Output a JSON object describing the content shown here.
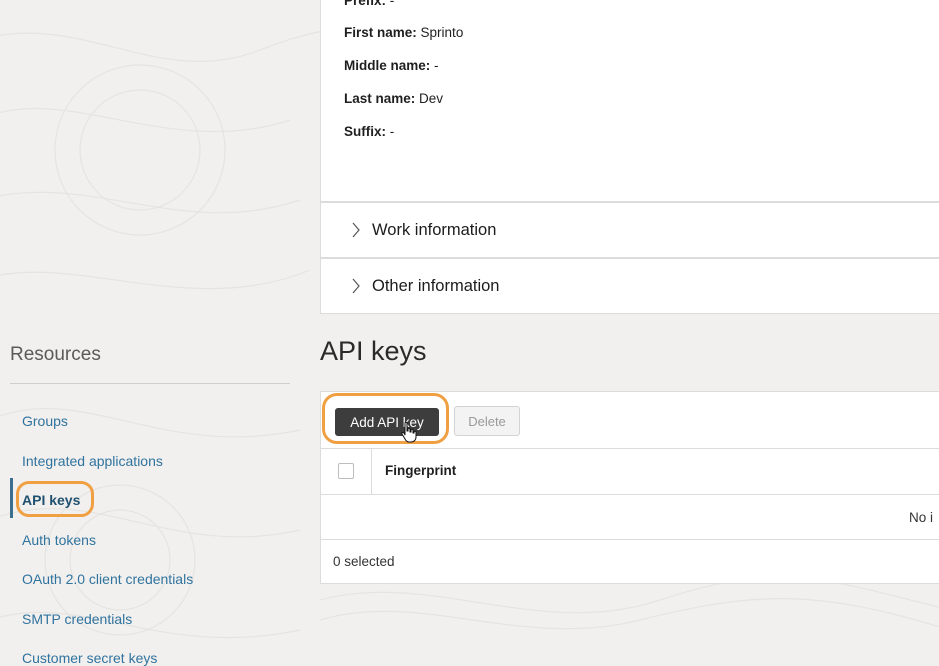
{
  "user_details": {
    "prefix": {
      "label": "Prefix:",
      "value": "-"
    },
    "first_name": {
      "label": "First name:",
      "value": "Sprinto"
    },
    "middle_name": {
      "label": "Middle name:",
      "value": "-"
    },
    "last_name": {
      "label": "Last name:",
      "value": "Dev"
    },
    "suffix": {
      "label": "Suffix:",
      "value": "-"
    }
  },
  "sections": {
    "work_information": "Work information",
    "other_information": "Other information"
  },
  "resources": {
    "title": "Resources",
    "items": [
      {
        "label": "Groups"
      },
      {
        "label": "Integrated applications"
      },
      {
        "label": "API keys",
        "active": true
      },
      {
        "label": "Auth tokens"
      },
      {
        "label": "OAuth 2.0 client credentials"
      },
      {
        "label": "SMTP credentials"
      },
      {
        "label": "Customer secret keys"
      }
    ]
  },
  "api_keys": {
    "title": "API keys",
    "add_button": "Add API key",
    "delete_button": "Delete",
    "columns": [
      "Fingerprint"
    ],
    "empty_text": "No i",
    "selected_text": "0 selected"
  },
  "colors": {
    "highlight": "#f0a043",
    "link": "#30739f",
    "active_marker": "#3b6e8f",
    "primary_button": "#3d3d3d"
  }
}
